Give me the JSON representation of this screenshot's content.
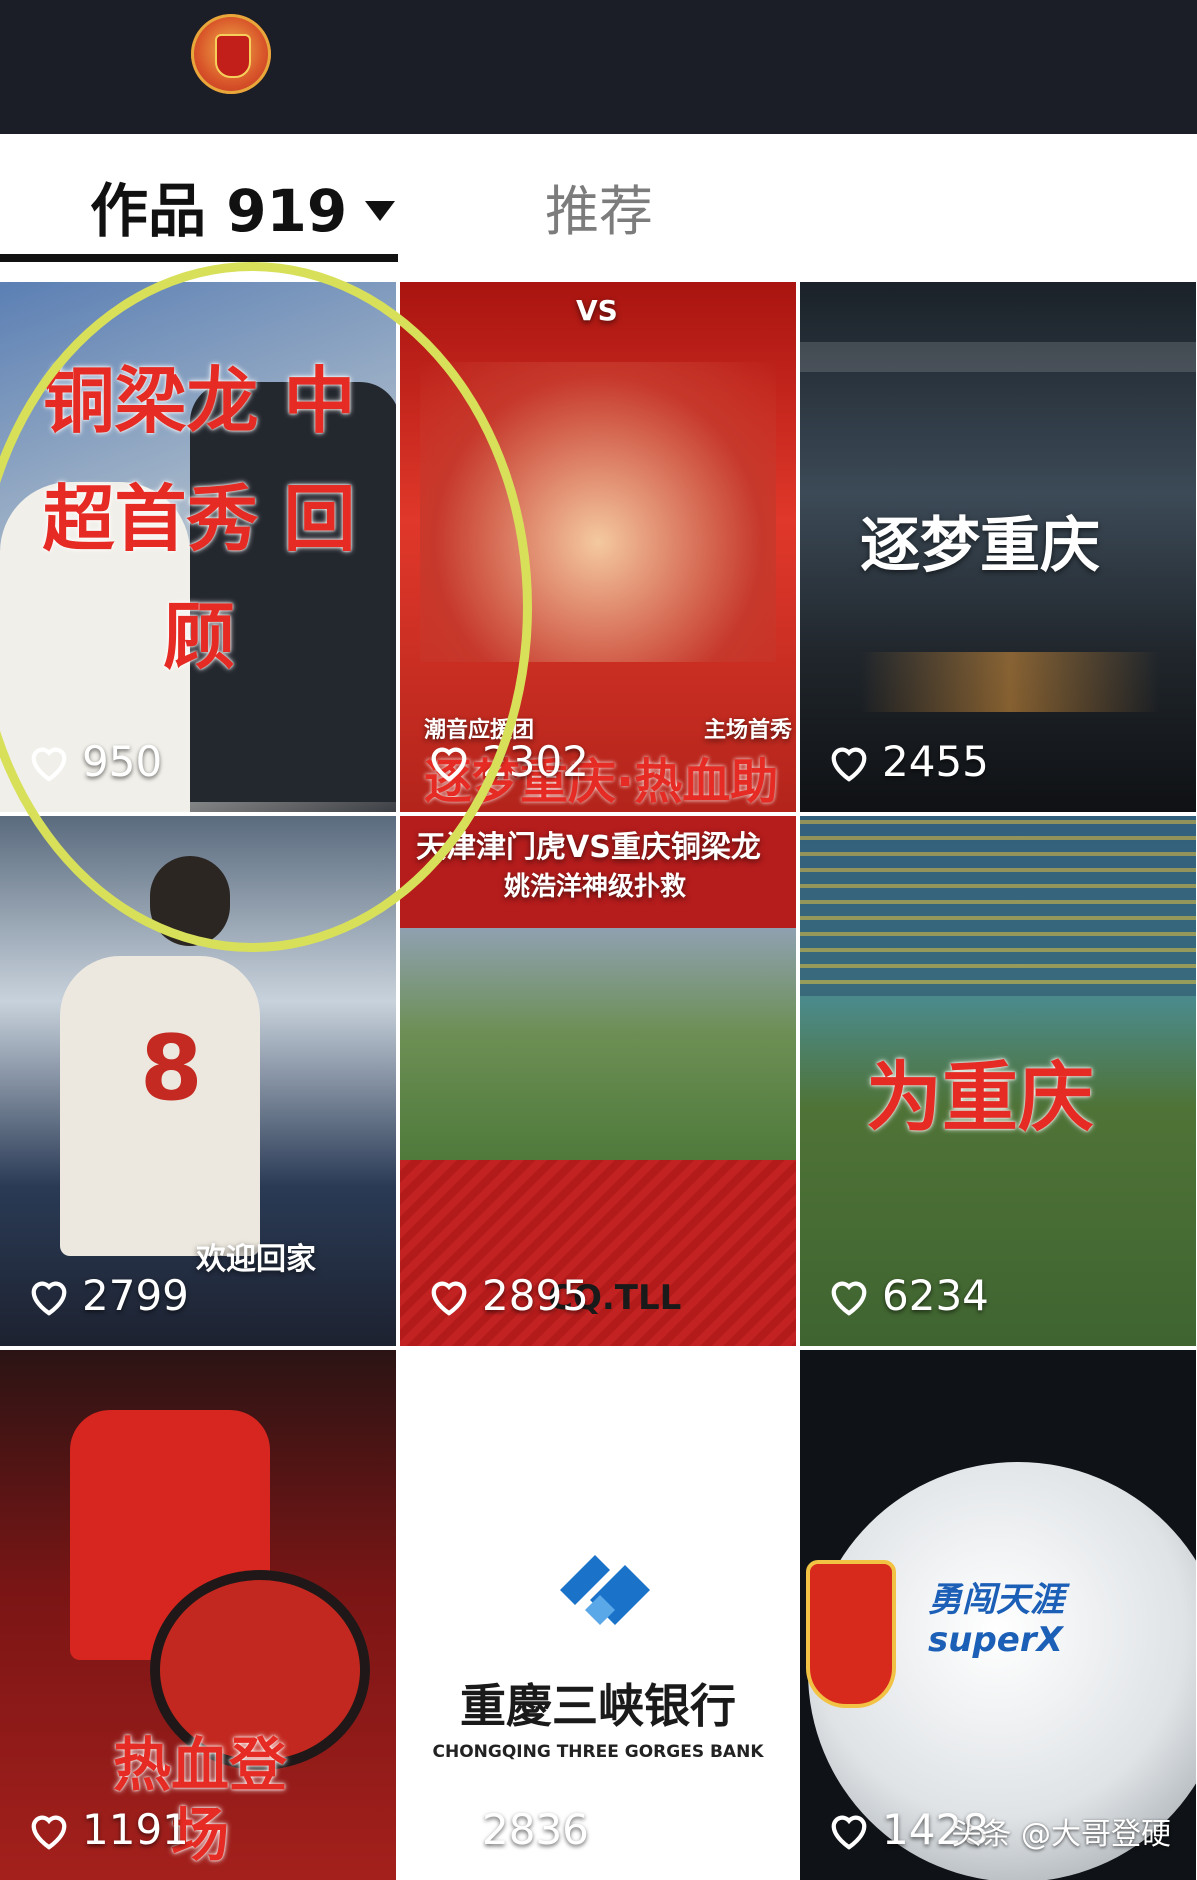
{
  "header": {
    "avatar": "team-crest"
  },
  "tabs": {
    "works_label": "作品 919",
    "recommend_label": "推荐"
  },
  "tiles": [
    {
      "likes": "950",
      "caption": "铜梁龙 中超首秀 回顾"
    },
    {
      "likes": "2302",
      "caption_top": "VS",
      "caption": "逐梦重庆·热血助威",
      "sub_left": "潮音应援团",
      "sub_right": "主场首秀"
    },
    {
      "likes": "2455",
      "caption": "逐梦重庆"
    },
    {
      "likes": "2799",
      "caption": "欢迎回家"
    },
    {
      "likes": "2895",
      "caption": "天津津门虎VS重庆铜梁龙",
      "sub": "姚浩洋神级扑救",
      "logo": "CQ.TLL"
    },
    {
      "likes": "6234",
      "caption": "为重庆"
    },
    {
      "likes": "1191",
      "caption": "热血登场"
    },
    {
      "likes": "2836",
      "caption": "重慶三峡银行",
      "sub": "CHONGQING THREE GORGES BANK"
    },
    {
      "likes": "1428",
      "caption": "勇闯天涯 superX"
    }
  ],
  "watermark": "头条 @大哥登硬",
  "colors": {
    "topbar": "#1b1e27",
    "accent_red": "#e52b23",
    "highlight_circle": "#d8e05a"
  }
}
